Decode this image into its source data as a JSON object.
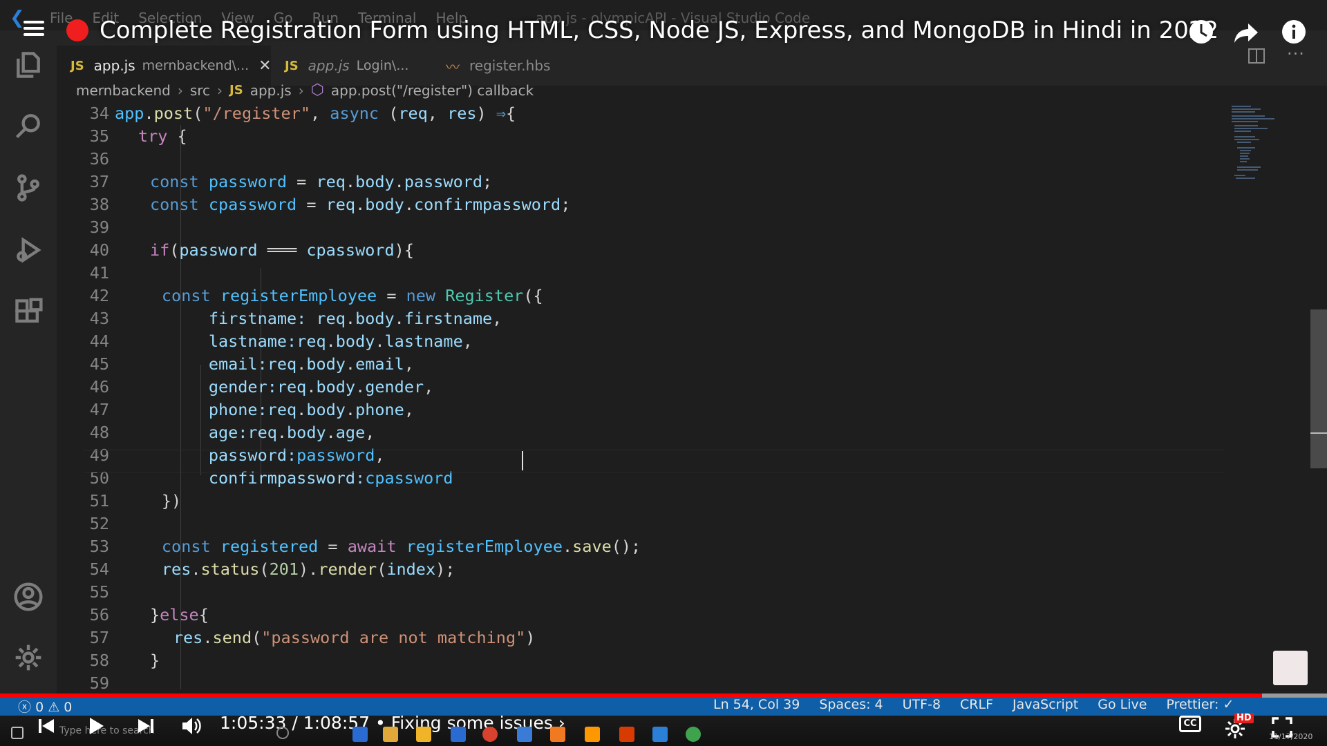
{
  "window": {
    "menu": [
      "File",
      "Edit",
      "Selection",
      "View",
      "Go",
      "Run",
      "Terminal",
      "Help"
    ],
    "title": "app.js - olympicAPI - Visual Studio Code"
  },
  "video": {
    "title": "Complete Registration Form using HTML, CSS, Node JS, Express, and MongoDB in Hindi in 2022",
    "time": "1:05:33 / 1:08:57 • Fixing some issues ›",
    "progress_fraction": 0.951,
    "cc_label": "CC",
    "hd_label": "HD"
  },
  "tabs": [
    {
      "lang": "JS",
      "name": "app.js",
      "path": "mernbackend\\...",
      "active": true
    },
    {
      "lang": "JS",
      "name": "app.js",
      "path": "Login\\...",
      "active": false
    },
    {
      "lang": "hbs",
      "name": "register.hbs",
      "path": "",
      "active": false
    }
  ],
  "breadcrumb": {
    "items": [
      "mernbackend",
      "src"
    ],
    "file_lang": "JS",
    "file": "app.js",
    "symbol": "app.post(\"/register\") callback"
  },
  "editor": {
    "lines": [
      {
        "n": "34",
        "tokens": [
          [
            "app",
            "v"
          ],
          [
            ".",
            "p"
          ],
          [
            "post",
            "f"
          ],
          [
            "(",
            "p"
          ],
          [
            "\"/register\"",
            "s"
          ],
          [
            ", ",
            "p"
          ],
          [
            "async",
            "k"
          ],
          [
            " (",
            "p"
          ],
          [
            "req",
            "vv"
          ],
          [
            ", ",
            "p"
          ],
          [
            "res",
            "vv"
          ],
          [
            ") ",
            "p"
          ],
          [
            "⇒",
            "k"
          ],
          [
            "{",
            "p"
          ]
        ],
        "indent": 0
      },
      {
        "n": "35",
        "tokens": [
          [
            "try",
            "c"
          ],
          [
            " {",
            "p"
          ]
        ],
        "indent": 2
      },
      {
        "n": "36",
        "tokens": [],
        "indent": 0
      },
      {
        "n": "37",
        "tokens": [
          [
            "const ",
            "k"
          ],
          [
            "password",
            "v"
          ],
          [
            " = ",
            "p"
          ],
          [
            "req",
            "vv"
          ],
          [
            ".",
            "p"
          ],
          [
            "body",
            "vv"
          ],
          [
            ".",
            "p"
          ],
          [
            "password",
            "vv"
          ],
          [
            ";",
            "p"
          ]
        ],
        "indent": 3
      },
      {
        "n": "38",
        "tokens": [
          [
            "const ",
            "k"
          ],
          [
            "cpassword",
            "v"
          ],
          [
            " = ",
            "p"
          ],
          [
            "req",
            "vv"
          ],
          [
            ".",
            "p"
          ],
          [
            "body",
            "vv"
          ],
          [
            ".",
            "p"
          ],
          [
            "confirmpassword",
            "vv"
          ],
          [
            ";",
            "p"
          ]
        ],
        "indent": 3
      },
      {
        "n": "39",
        "tokens": [],
        "indent": 0
      },
      {
        "n": "40",
        "tokens": [
          [
            "if",
            "c"
          ],
          [
            "(",
            "p"
          ],
          [
            "password",
            "vv"
          ],
          [
            " ═══ ",
            "p"
          ],
          [
            "cpassword",
            "vv"
          ],
          [
            ")",
            "p"
          ],
          [
            "{",
            "d"
          ]
        ],
        "indent": 3
      },
      {
        "n": "41",
        "tokens": [],
        "indent": 0
      },
      {
        "n": "42",
        "tokens": [
          [
            "const ",
            "k"
          ],
          [
            "registerEmployee",
            "v"
          ],
          [
            " = ",
            "p"
          ],
          [
            "new ",
            "k"
          ],
          [
            "Register",
            "t"
          ],
          [
            "({",
            "p"
          ]
        ],
        "indent": 4
      },
      {
        "n": "43",
        "tokens": [
          [
            "firstname: ",
            "vv"
          ],
          [
            "req",
            "vv"
          ],
          [
            ".",
            "p"
          ],
          [
            "body",
            "vv"
          ],
          [
            ".",
            "p"
          ],
          [
            "firstname",
            "vv"
          ],
          [
            ",",
            "p"
          ]
        ],
        "indent": 8
      },
      {
        "n": "44",
        "tokens": [
          [
            "lastname:",
            "vv"
          ],
          [
            "req",
            "vv"
          ],
          [
            ".",
            "p"
          ],
          [
            "body",
            "vv"
          ],
          [
            ".",
            "p"
          ],
          [
            "lastname",
            "vv"
          ],
          [
            ",",
            "p"
          ]
        ],
        "indent": 8
      },
      {
        "n": "45",
        "tokens": [
          [
            "email:",
            "vv"
          ],
          [
            "req",
            "vv"
          ],
          [
            ".",
            "p"
          ],
          [
            "body",
            "vv"
          ],
          [
            ".",
            "p"
          ],
          [
            "email",
            "vv"
          ],
          [
            ",",
            "p"
          ]
        ],
        "indent": 8
      },
      {
        "n": "46",
        "tokens": [
          [
            "gender:",
            "vv"
          ],
          [
            "req",
            "vv"
          ],
          [
            ".",
            "p"
          ],
          [
            "body",
            "vv"
          ],
          [
            ".",
            "p"
          ],
          [
            "gender",
            "vv"
          ],
          [
            ",",
            "p"
          ]
        ],
        "indent": 8
      },
      {
        "n": "47",
        "tokens": [
          [
            "phone:",
            "vv"
          ],
          [
            "req",
            "vv"
          ],
          [
            ".",
            "p"
          ],
          [
            "body",
            "vv"
          ],
          [
            ".",
            "p"
          ],
          [
            "phone",
            "vv"
          ],
          [
            ",",
            "p"
          ]
        ],
        "indent": 8
      },
      {
        "n": "48",
        "tokens": [
          [
            "age:",
            "vv"
          ],
          [
            "req",
            "vv"
          ],
          [
            ".",
            "p"
          ],
          [
            "body",
            "vv"
          ],
          [
            ".",
            "p"
          ],
          [
            "age",
            "vv"
          ],
          [
            ",",
            "p"
          ]
        ],
        "indent": 8
      },
      {
        "n": "49",
        "tokens": [
          [
            "password:",
            "vv"
          ],
          [
            "password",
            "v"
          ],
          [
            ",",
            "p"
          ]
        ],
        "indent": 8
      },
      {
        "n": "50",
        "tokens": [
          [
            "confirmpassword:",
            "vv"
          ],
          [
            "cpassword",
            "v"
          ]
        ],
        "indent": 8
      },
      {
        "n": "51",
        "tokens": [
          [
            "})",
            "p"
          ]
        ],
        "indent": 4
      },
      {
        "n": "52",
        "tokens": [],
        "indent": 0
      },
      {
        "n": "53",
        "tokens": [
          [
            "const ",
            "k"
          ],
          [
            "registered",
            "v"
          ],
          [
            " = ",
            "p"
          ],
          [
            "await ",
            "c"
          ],
          [
            "registerEmployee",
            "v"
          ],
          [
            ".",
            "p"
          ],
          [
            "save",
            "f"
          ],
          [
            "();",
            "p"
          ]
        ],
        "indent": 4
      },
      {
        "n": "54",
        "tokens": [
          [
            "res",
            "vv"
          ],
          [
            ".",
            "p"
          ],
          [
            "status",
            "f"
          ],
          [
            "(",
            "p"
          ],
          [
            "201",
            "n"
          ],
          [
            ").",
            "p"
          ],
          [
            "render",
            "f"
          ],
          [
            "(",
            "p"
          ],
          [
            "index",
            "vv"
          ],
          [
            ");",
            "p"
          ]
        ],
        "indent": 4
      },
      {
        "n": "55",
        "tokens": [],
        "indent": 0
      },
      {
        "n": "56",
        "tokens": [
          [
            "}",
            "d"
          ],
          [
            "else",
            "c"
          ],
          [
            "{",
            "p"
          ]
        ],
        "indent": 3
      },
      {
        "n": "57",
        "tokens": [
          [
            "res",
            "vv"
          ],
          [
            ".",
            "p"
          ],
          [
            "send",
            "f"
          ],
          [
            "(",
            "p"
          ],
          [
            "\"password are not matching\"",
            "s"
          ],
          [
            ")",
            "p"
          ]
        ],
        "indent": 5
      },
      {
        "n": "58",
        "tokens": [
          [
            "}",
            "p"
          ]
        ],
        "indent": 3
      },
      {
        "n": "59",
        "tokens": [],
        "indent": 0
      }
    ]
  },
  "status": {
    "errors": "0",
    "warnings": "0",
    "right": [
      "Ln 54, Col 39",
      "Spaces: 4",
      "UTF-8",
      "CRLF",
      "JavaScript",
      "Go Live",
      "Prettier: ✓"
    ]
  },
  "taskbar": {
    "search_placeholder": "Type here to search",
    "clock": "11/17/2020"
  },
  "icons": [
    "vscode-logo-icon",
    "explorer-icon",
    "search-icon",
    "source-control-icon",
    "run-debug-icon",
    "extensions-icon",
    "accounts-icon",
    "manage-gear-icon",
    "clock-icon",
    "share-icon",
    "info-icon",
    "menu-icon",
    "live-dot-icon",
    "prev-icon",
    "play-icon",
    "next-icon",
    "volume-icon",
    "settings-gear-icon",
    "fullscreen-icon"
  ],
  "colors": {
    "statusbar": "#0f5ea8",
    "progress": "#ff0000",
    "editor_bg": "#1e1e1e",
    "live_dot": "#f01e1e"
  }
}
